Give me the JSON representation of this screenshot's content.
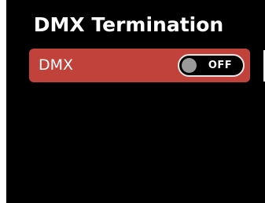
{
  "screen": {
    "title": "DMX Termination"
  },
  "settings": {
    "rows": [
      {
        "label": "DMX",
        "toggle": {
          "state_label": "OFF",
          "on": false
        }
      }
    ]
  },
  "colors": {
    "background": "#000000",
    "row_selected": "#c1423a",
    "text": "#ffffff",
    "toggle_knob_off": "#9a9a9a"
  }
}
